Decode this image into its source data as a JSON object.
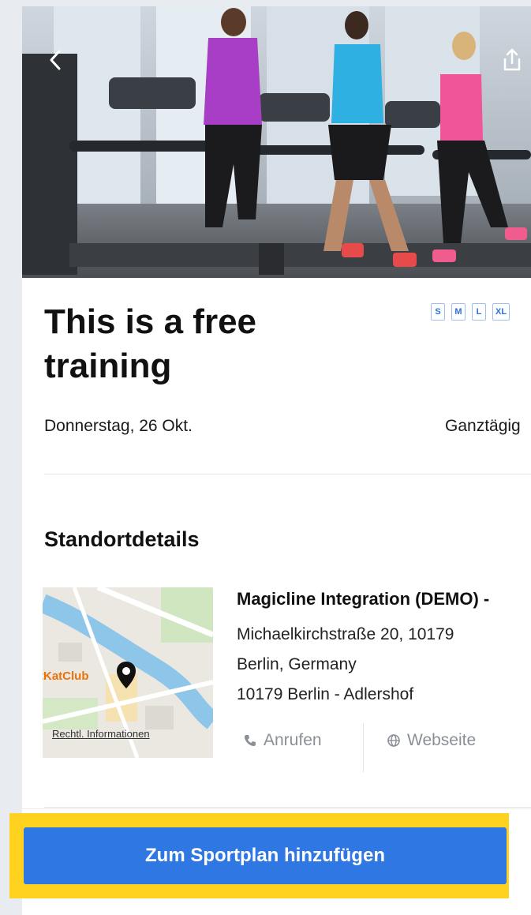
{
  "hero": {
    "back_icon": "chevron-left-icon",
    "share_icon": "share-icon"
  },
  "event": {
    "title": "This is a free training",
    "sizes": [
      "S",
      "M",
      "L",
      "XL"
    ],
    "date": "Donnerstag, 26 Okt.",
    "time_info": "Ganztägig"
  },
  "location": {
    "section_title": "Standortdetails",
    "map_label": "tKatClub",
    "map_legal": "Rechtl. Informationen",
    "name": "Magicline Integration (DEMO) -",
    "address_line1": "Michaelkirchstraße 20, 10179",
    "address_line2": "Berlin, Germany",
    "address_line3": "10179 Berlin - Adlershof",
    "call_label": "Anrufen",
    "call_icon": "phone-icon",
    "website_label": "Webseite",
    "website_icon": "globe-icon"
  },
  "cta": {
    "label": "Zum Sportplan hinzufügen",
    "color": "#2f78e4",
    "highlight_color": "#ffd21f"
  }
}
